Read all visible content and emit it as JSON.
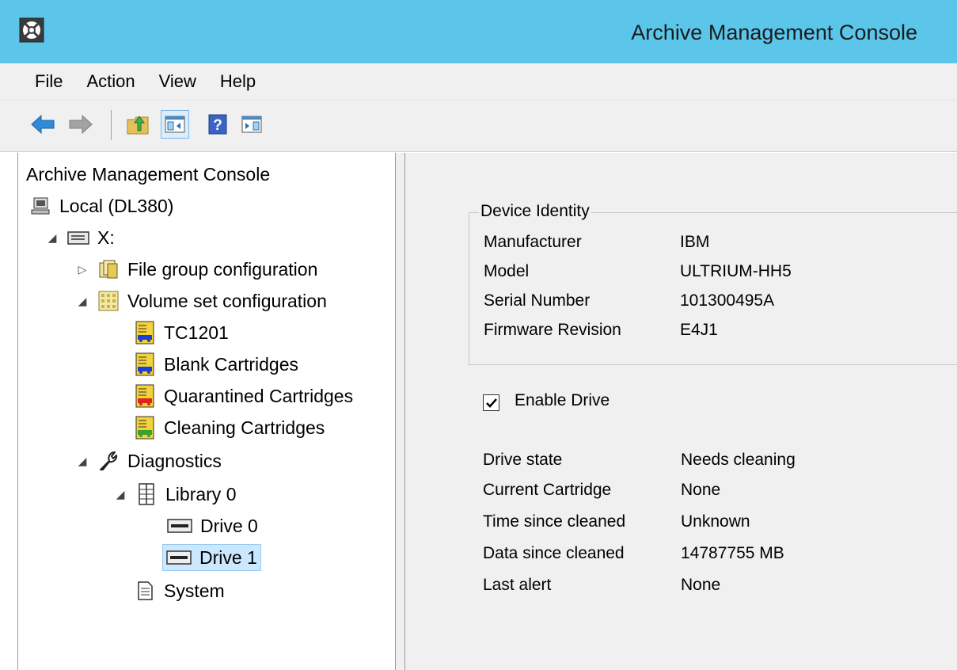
{
  "window": {
    "title": "Archive Management Console",
    "app_icon": "mmc-snapin-icon"
  },
  "menu": {
    "items": [
      "File",
      "Action",
      "View",
      "Help"
    ]
  },
  "toolbar": {
    "buttons": [
      {
        "icon": "back-arrow-icon"
      },
      {
        "icon": "forward-arrow-icon"
      },
      {
        "icon": "up-folder-icon"
      },
      {
        "icon": "show-hide-console-tree-icon",
        "active": true
      },
      {
        "icon": "help-icon"
      },
      {
        "icon": "show-hide-action-pane-icon"
      }
    ]
  },
  "tree": {
    "root": "Archive Management Console",
    "nodes": [
      {
        "label": "Local (DL380)",
        "icon": "computer-icon"
      },
      {
        "label": "X:",
        "icon": "drive-icon",
        "expanded": true
      },
      {
        "label": "File group configuration",
        "icon": "file-group-icon",
        "expanded": false
      },
      {
        "label": "Volume set configuration",
        "icon": "volume-set-icon",
        "expanded": true
      },
      {
        "label": "TC1201",
        "icon": "cartridge-set-blue-icon"
      },
      {
        "label": "Blank Cartridges",
        "icon": "cartridge-set-blue-icon"
      },
      {
        "label": "Quarantined Cartridges",
        "icon": "cartridge-set-red-icon"
      },
      {
        "label": "Cleaning Cartridges",
        "icon": "cartridge-set-green-icon"
      },
      {
        "label": "Diagnostics",
        "icon": "wrench-icon",
        "expanded": true
      },
      {
        "label": "Library 0",
        "icon": "library-icon",
        "expanded": true
      },
      {
        "label": "Drive 0",
        "icon": "tape-drive-icon"
      },
      {
        "label": "Drive 1",
        "icon": "tape-drive-icon",
        "selected": true
      },
      {
        "label": "System",
        "icon": "system-document-icon"
      }
    ]
  },
  "details": {
    "device_identity": {
      "legend": "Device Identity",
      "rows": [
        {
          "label": "Manufacturer",
          "value": "IBM"
        },
        {
          "label": "Model",
          "value": "ULTRIUM-HH5"
        },
        {
          "label": "Serial Number",
          "value": "101300495A"
        },
        {
          "label": "Firmware Revision",
          "value": "E4J1"
        }
      ]
    },
    "enable_drive": {
      "label": "Enable Drive",
      "checked": true
    },
    "status_rows": [
      {
        "label": "Drive state",
        "value": "Needs cleaning"
      },
      {
        "label": "Current Cartridge",
        "value": "None"
      },
      {
        "label": "Time since cleaned",
        "value": "Unknown"
      },
      {
        "label": "Data since cleaned",
        "value": "14787755 MB"
      },
      {
        "label": "Last alert",
        "value": "None"
      }
    ]
  },
  "colors": {
    "titlebar": "#5bc6ea",
    "selection": "#cce8ff",
    "chrome": "#f0f0f0"
  }
}
